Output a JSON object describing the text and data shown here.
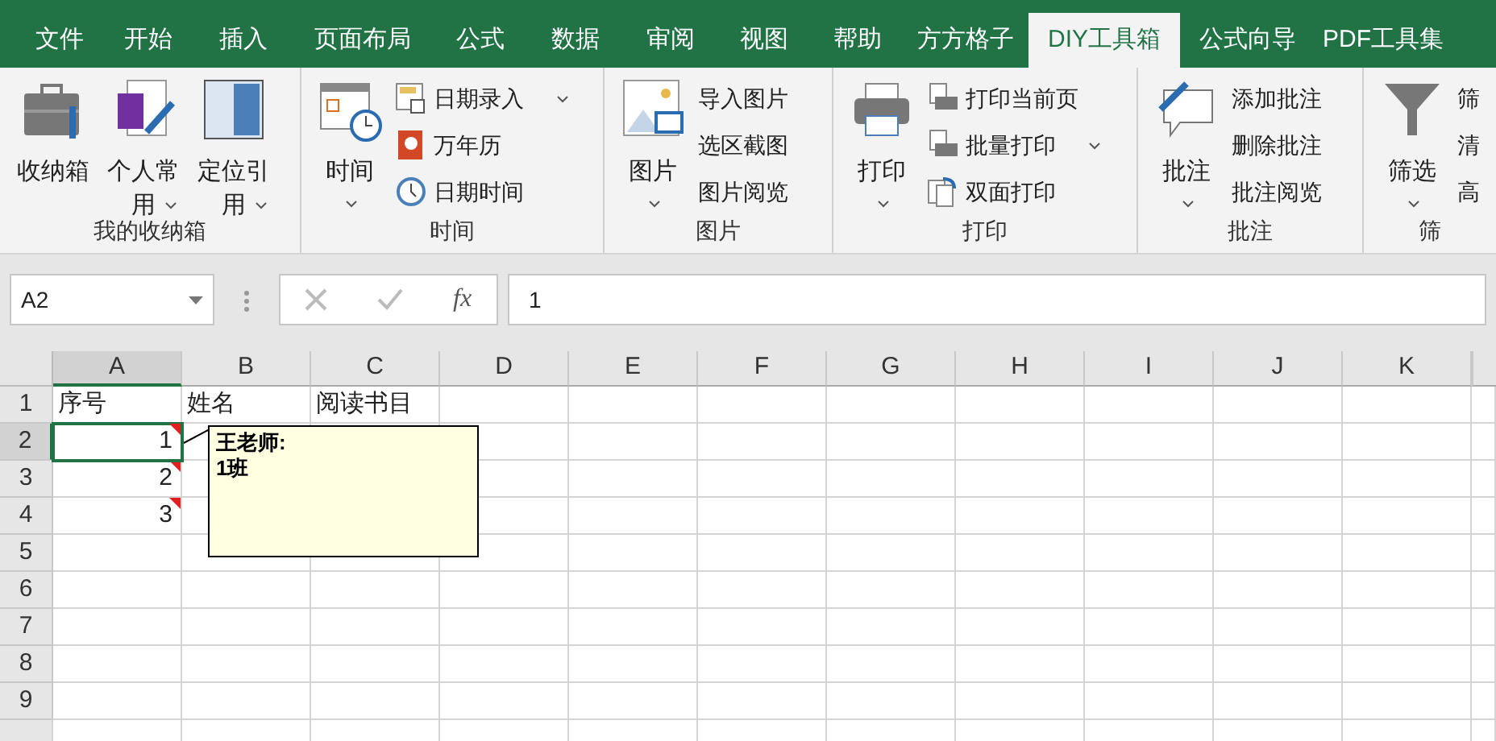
{
  "tabs": [
    {
      "label": "文件",
      "selected": false
    },
    {
      "label": "开始",
      "selected": false
    },
    {
      "label": "插入",
      "selected": false
    },
    {
      "label": "页面布局",
      "selected": false
    },
    {
      "label": "公式",
      "selected": false
    },
    {
      "label": "数据",
      "selected": false
    },
    {
      "label": "审阅",
      "selected": false
    },
    {
      "label": "视图",
      "selected": false
    },
    {
      "label": "帮助",
      "selected": false
    },
    {
      "label": "方方格子",
      "selected": false
    },
    {
      "label": "DIY工具箱",
      "selected": true
    },
    {
      "label": "公式向导",
      "selected": false
    },
    {
      "label": "PDF工具集",
      "selected": false
    }
  ],
  "ribbon_groups": [
    {
      "label": "我的收纳箱",
      "large": [
        {
          "label": "收纳箱",
          "dropdown": false
        },
        {
          "label": "个人常用",
          "dropdown": true
        },
        {
          "label": "定位引用",
          "dropdown": true
        }
      ]
    },
    {
      "label": "时间",
      "large": [
        {
          "label": "时间",
          "dropdown": true
        }
      ],
      "small": [
        {
          "label": "日期录入",
          "dropdown": true
        },
        {
          "label": "万年历",
          "dropdown": false
        },
        {
          "label": "日期时间",
          "dropdown": false
        }
      ]
    },
    {
      "label": "图片",
      "large": [
        {
          "label": "图片",
          "dropdown": true
        }
      ],
      "small": [
        {
          "label": "导入图片",
          "dropdown": false
        },
        {
          "label": "选区截图",
          "dropdown": false
        },
        {
          "label": "图片阅览",
          "dropdown": false
        }
      ]
    },
    {
      "label": "打印",
      "large": [
        {
          "label": "打印",
          "dropdown": true
        }
      ],
      "small": [
        {
          "label": "打印当前页",
          "dropdown": false
        },
        {
          "label": "批量打印",
          "dropdown": true
        },
        {
          "label": "双面打印",
          "dropdown": false
        }
      ]
    },
    {
      "label": "批注",
      "large": [
        {
          "label": "批注",
          "dropdown": true
        }
      ],
      "small": [
        {
          "label": "添加批注",
          "dropdown": false
        },
        {
          "label": "删除批注",
          "dropdown": false
        },
        {
          "label": "批注阅览",
          "dropdown": false
        }
      ]
    },
    {
      "label": "筛",
      "large": [
        {
          "label": "筛选",
          "dropdown": true
        }
      ],
      "small": [
        {
          "label": "筛",
          "dropdown": false
        },
        {
          "label": "清",
          "dropdown": false
        },
        {
          "label": "高",
          "dropdown": false
        }
      ]
    }
  ],
  "name_box": "A2",
  "fx_label": "fx",
  "formula": "1",
  "columns": [
    {
      "label": "A",
      "selected": true
    },
    {
      "label": "B",
      "selected": false
    },
    {
      "label": "C",
      "selected": false
    },
    {
      "label": "D",
      "selected": false
    },
    {
      "label": "E",
      "selected": false
    },
    {
      "label": "F",
      "selected": false
    },
    {
      "label": "G",
      "selected": false
    },
    {
      "label": "H",
      "selected": false
    },
    {
      "label": "I",
      "selected": false
    },
    {
      "label": "J",
      "selected": false
    },
    {
      "label": "K",
      "selected": false
    }
  ],
  "rows": [
    {
      "label": "1",
      "selected": false,
      "cells": [
        {
          "text": "序号",
          "kind": "text",
          "has_comment": false
        },
        {
          "text": "姓名",
          "kind": "text",
          "has_comment": false
        },
        {
          "text": "阅读书目",
          "kind": "text",
          "has_comment": false
        }
      ]
    },
    {
      "label": "2",
      "selected": true,
      "cells": [
        {
          "text": "1",
          "kind": "number",
          "has_comment": true
        }
      ]
    },
    {
      "label": "3",
      "selected": false,
      "cells": [
        {
          "text": "2",
          "kind": "number",
          "has_comment": true
        }
      ]
    },
    {
      "label": "4",
      "selected": false,
      "cells": [
        {
          "text": "3",
          "kind": "number",
          "has_comment": true
        }
      ]
    },
    {
      "label": "5",
      "selected": false,
      "cells": []
    },
    {
      "label": "6",
      "selected": false,
      "cells": []
    },
    {
      "label": "7",
      "selected": false,
      "cells": []
    },
    {
      "label": "8",
      "selected": false,
      "cells": []
    },
    {
      "label": "9",
      "selected": false,
      "cells": []
    }
  ],
  "comment": {
    "author": "王老师:",
    "text": "1班"
  }
}
